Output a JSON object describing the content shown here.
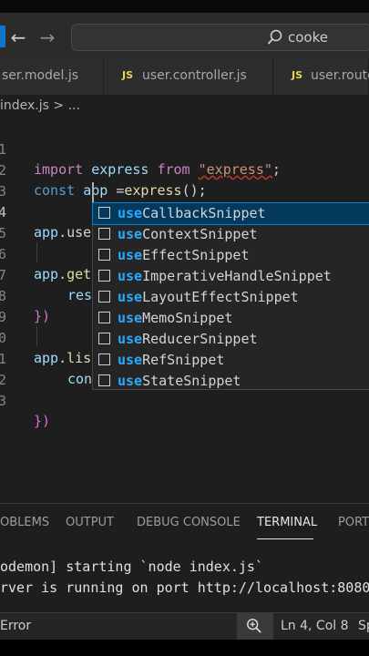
{
  "title_bar": {
    "search_text": "cooke",
    "back_icon": "arrow-left-icon",
    "forward_icon": "arrow-right-icon"
  },
  "tabs": [
    {
      "label": "ser.model.js",
      "has_js_badge": false
    },
    {
      "label": "user.controller.js",
      "badge": "JS"
    },
    {
      "label": "user.route",
      "badge": "JS"
    }
  ],
  "breadcrumb": "index.js > ...",
  "editor": {
    "line_numbers": [
      "1",
      "2",
      "3",
      "4",
      "5",
      "6",
      "7",
      "8",
      "9",
      "0",
      "1",
      "2",
      "3"
    ],
    "line1": {
      "kw1": "import",
      "id": "express",
      "kw2": "from",
      "str": "\"express\"",
      "end": ";"
    },
    "line2": {
      "kw": "const",
      "id": "app",
      "op": "=",
      "fn": "express",
      "end": "();"
    },
    "line4": {
      "id": "app",
      "rest": ".use"
    },
    "line6": {
      "id": "app",
      "rest": ".get"
    },
    "line7": {
      "fn": "res"
    },
    "line8": {
      "text": "})"
    },
    "line10": {
      "id": "app",
      "rest": ".lis"
    },
    "line11": {
      "fn": "con"
    },
    "line13": {
      "text": "})"
    }
  },
  "suggestions": {
    "match": "use",
    "items": [
      "CallbackSnippet",
      "ContextSnippet",
      "EffectSnippet",
      "ImperativeHandleSnippet",
      "LayoutEffectSnippet",
      "MemoSnippet",
      "ReducerSnippet",
      "RefSnippet",
      "StateSnippet"
    ],
    "selected_index": 0
  },
  "panel": {
    "tabs": [
      "OBLEMS",
      "OUTPUT",
      "DEBUG CONSOLE",
      "TERMINAL",
      "PORT"
    ],
    "active_tab": "TERMINAL",
    "terminal_lines": [
      "odemon] starting `node index.js`",
      "rver is running on port http://localhost:8080"
    ]
  },
  "status_bar": {
    "left": "Error",
    "position": "Ln 4, Col 8",
    "right_partial": "Sp"
  },
  "colors": {
    "editor_bg": "#1e1e1e",
    "keyword": "#c586c0",
    "variable": "#9cdcfe",
    "function": "#dcdcaa",
    "string": "#ce9178",
    "match_highlight": "#2aaaff",
    "selection": "#04395e"
  }
}
